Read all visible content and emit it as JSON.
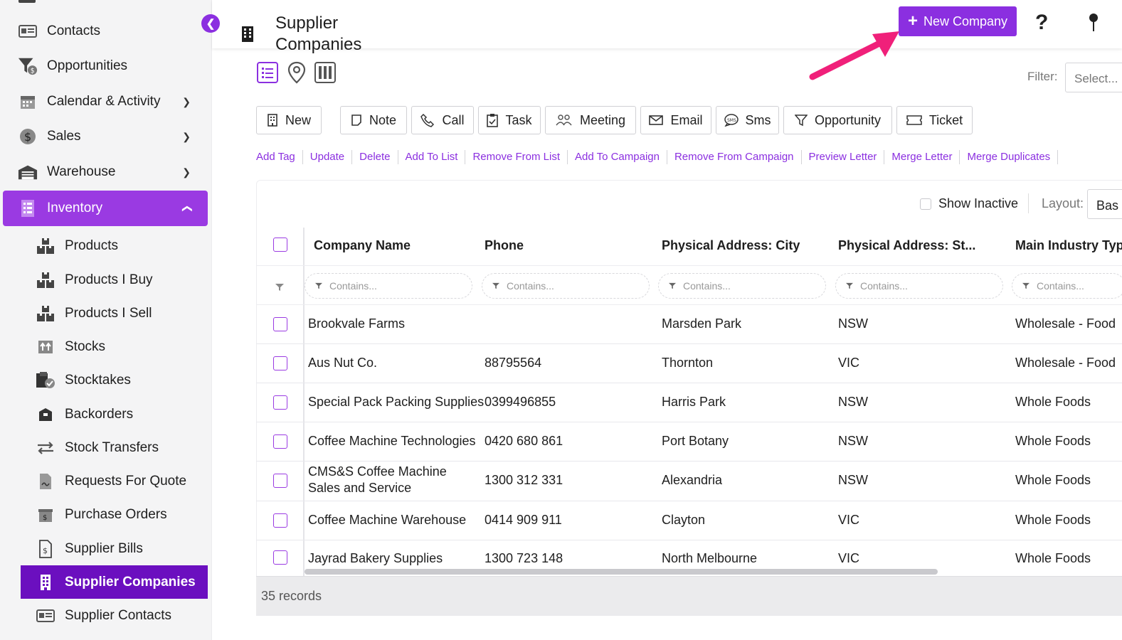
{
  "sidebar": {
    "items": [
      {
        "label": "Contacts",
        "icon": "contact-card-icon"
      },
      {
        "label": "Opportunities",
        "icon": "funnel-dollar-icon"
      },
      {
        "label": "Calendar & Activity",
        "icon": "calendar-icon",
        "chevron": "down"
      },
      {
        "label": "Sales",
        "icon": "dollar-circle-icon",
        "chevron": "down"
      },
      {
        "label": "Warehouse",
        "icon": "warehouse-icon",
        "chevron": "down"
      },
      {
        "label": "Inventory",
        "icon": "inventory-list-icon",
        "chevron": "up",
        "active": true
      }
    ],
    "subitems": [
      {
        "label": "Products",
        "icon": "boxes-icon"
      },
      {
        "label": "Products I Buy",
        "icon": "boxes-icon"
      },
      {
        "label": "Products I Sell",
        "icon": "boxes-icon"
      },
      {
        "label": "Stocks",
        "icon": "stock-arrows-icon"
      },
      {
        "label": "Stocktakes",
        "icon": "stocktake-check-icon"
      },
      {
        "label": "Backorders",
        "icon": "backorder-box-icon"
      },
      {
        "label": "Stock Transfers",
        "icon": "transfer-arrows-icon"
      },
      {
        "label": "Requests For Quote",
        "icon": "quote-document-icon"
      },
      {
        "label": "Purchase Orders",
        "icon": "purchase-box-icon"
      },
      {
        "label": "Supplier Bills",
        "icon": "bill-dollar-icon"
      },
      {
        "label": "Supplier Companies",
        "icon": "building-icon",
        "active": true
      },
      {
        "label": "Supplier Contacts",
        "icon": "contact-card-icon"
      }
    ]
  },
  "header": {
    "title": "Supplier Companies",
    "new_company_label": "New Company",
    "help_icon": "?"
  },
  "filter": {
    "label": "Filter:",
    "placeholder": "Select..."
  },
  "actions": [
    {
      "label": "New",
      "icon": "building-icon"
    },
    {
      "label": "Note",
      "icon": "note-icon"
    },
    {
      "label": "Call",
      "icon": "phone-icon"
    },
    {
      "label": "Task",
      "icon": "task-clipboard-icon"
    },
    {
      "label": "Meeting",
      "icon": "meeting-people-icon"
    },
    {
      "label": "Email",
      "icon": "envelope-icon"
    },
    {
      "label": "Sms",
      "icon": "sms-bubble-icon"
    },
    {
      "label": "Opportunity",
      "icon": "funnel-icon"
    },
    {
      "label": "Ticket",
      "icon": "ticket-icon"
    }
  ],
  "links": [
    "Add Tag",
    "Update",
    "Delete",
    "Add To List",
    "Remove From List",
    "Add To Campaign",
    "Remove From Campaign",
    "Preview Letter",
    "Merge Letter",
    "Merge Duplicates"
  ],
  "grid": {
    "show_inactive_label": "Show Inactive",
    "layout_label": "Layout:",
    "layout_value": "Bas",
    "filter_placeholder": "Contains...",
    "columns": [
      "Company Name",
      "Phone",
      "Physical Address: City",
      "Physical Address: St...",
      "Main Industry Typ"
    ],
    "rows": [
      [
        "Brookvale Farms",
        "",
        "Marsden Park",
        "NSW",
        "Wholesale - Food"
      ],
      [
        "Aus Nut Co.",
        "88795564",
        "Thornton",
        "VIC",
        "Wholesale - Food"
      ],
      [
        "Special Pack Packing Supplies",
        "0399496855",
        "Harris Park",
        "NSW",
        "Whole Foods"
      ],
      [
        "Coffee Machine Technologies",
        "0420 680 861",
        "Port Botany",
        "NSW",
        "Whole Foods"
      ],
      [
        "CMS&S Coffee Machine Sales and Service",
        "1300 312 331",
        "Alexandria",
        "NSW",
        "Whole Foods"
      ],
      [
        "Coffee Machine Warehouse",
        "0414 909 911",
        "Clayton",
        "VIC",
        "Whole Foods"
      ],
      [
        "Jayrad Bakery Supplies",
        "1300 723 148",
        "North Melbourne",
        "VIC",
        "Whole Foods"
      ]
    ],
    "records_label": "35 records"
  },
  "colors": {
    "accent": "#8b2fe0",
    "active_nav": "#9a3ae2",
    "active_subnav": "#6b0fbf",
    "annotation_arrow": "#f0207a"
  }
}
